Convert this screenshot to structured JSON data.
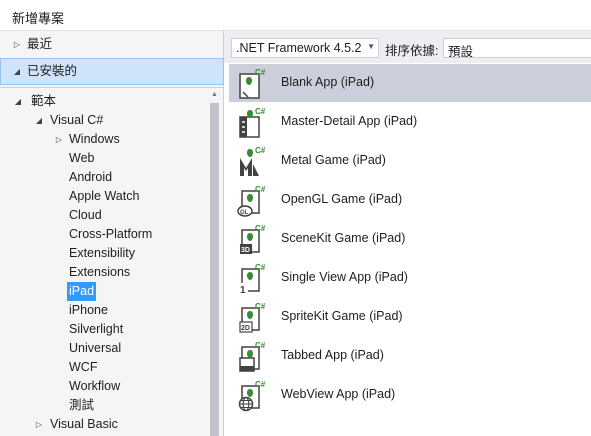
{
  "window": {
    "title": "新增專案"
  },
  "tree": {
    "recent": "最近",
    "installed": "已安裝的",
    "templates": "範本",
    "visual_csharp": "Visual C#",
    "windows": "Windows",
    "web": "Web",
    "android": "Android",
    "apple_watch": "Apple Watch",
    "cloud": "Cloud",
    "cross_platform": "Cross-Platform",
    "extensibility": "Extensibility",
    "extensions": "Extensions",
    "ipad": "iPad",
    "iphone": "iPhone",
    "silverlight": "Silverlight",
    "universal": "Universal",
    "wcf": "WCF",
    "workflow": "Workflow",
    "test": "測試",
    "visual_basic": "Visual Basic"
  },
  "toolbar": {
    "framework": ".NET Framework 4.5.2",
    "sort_label": "排序依據:",
    "sort_value": "預設"
  },
  "templates": [
    {
      "name": "Blank App (iPad)",
      "icon": "blank-app-icon",
      "selected": true
    },
    {
      "name": "Master-Detail App (iPad)",
      "icon": "master-detail-icon"
    },
    {
      "name": "Metal Game (iPad)",
      "icon": "metal-game-icon"
    },
    {
      "name": "OpenGL Game (iPad)",
      "icon": "opengl-game-icon"
    },
    {
      "name": "SceneKit Game (iPad)",
      "icon": "scenekit-game-icon"
    },
    {
      "name": "Single View App (iPad)",
      "icon": "single-view-icon"
    },
    {
      "name": "SpriteKit Game (iPad)",
      "icon": "spritekit-game-icon"
    },
    {
      "name": "Tabbed App (iPad)",
      "icon": "tabbed-app-icon"
    },
    {
      "name": "WebView App (iPad)",
      "icon": "webview-app-icon"
    }
  ],
  "icon_badges": {
    "csharp": "C#",
    "opengl": "GL",
    "scenekit": "3D",
    "single_view": "1",
    "spritekit": "2D"
  },
  "colors": {
    "selection_blue": "#3399ff",
    "installed_highlight": "#cfe4f9",
    "selected_template": "#cccedb",
    "csharp_green": "#388a34"
  }
}
